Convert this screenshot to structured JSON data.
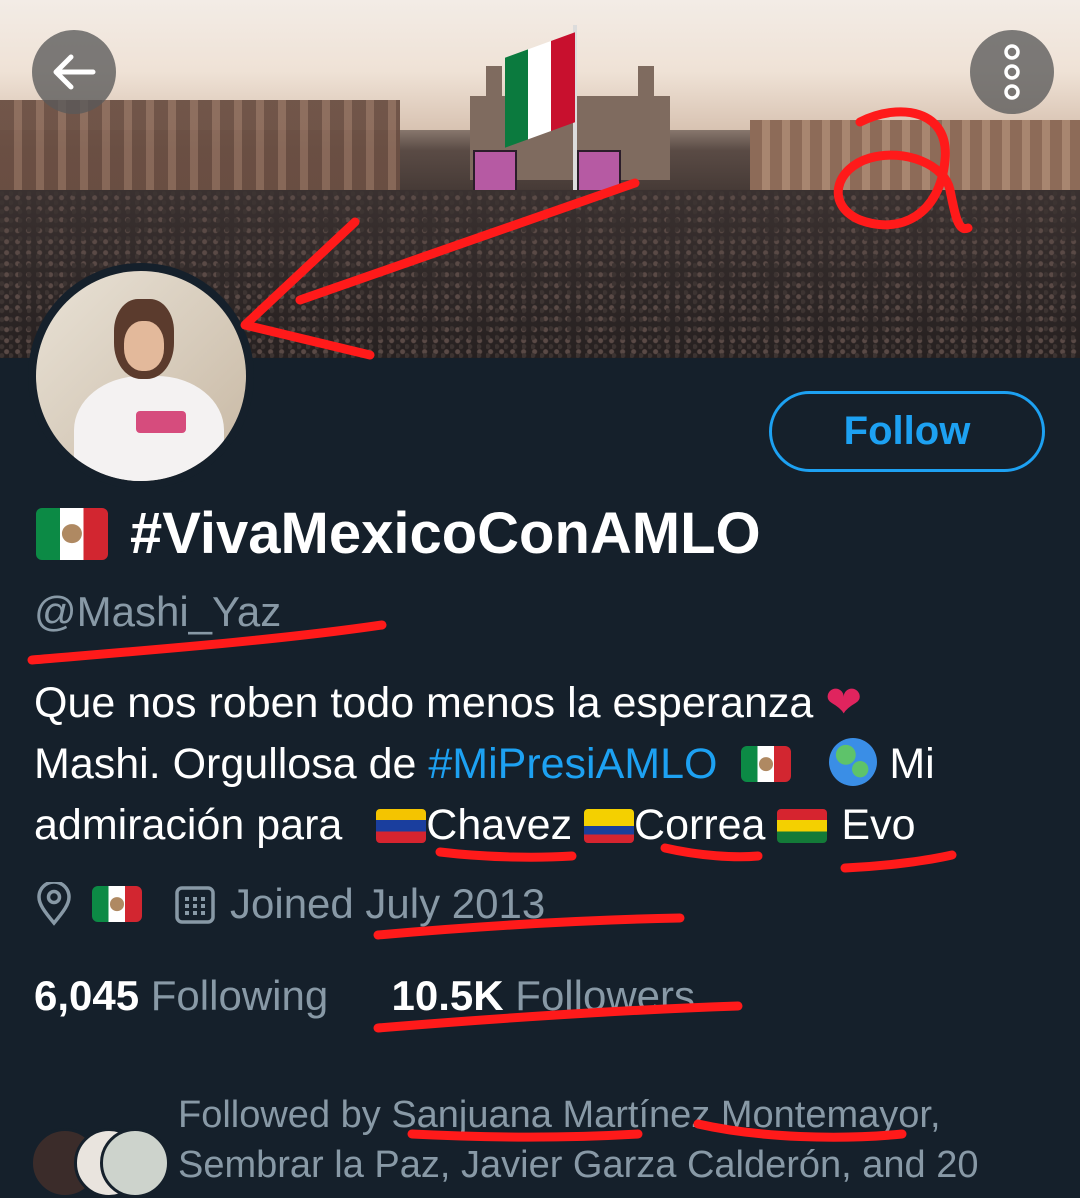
{
  "header": {
    "back_icon": "arrow-left-icon",
    "more_icon": "more-vertical-icon"
  },
  "profile": {
    "display_name": "#VivaMexicoConAMLO",
    "handle": "@Mashi_Yaz",
    "follow_label": "Follow",
    "bio_line1": "Que nos roben todo menos la esperanza",
    "bio_line2_prefix": "Mashi. Orgullosa de",
    "bio_hashtag": "#MiPresiAMLO",
    "bio_line2_suffix": "Mi",
    "bio_line3_prefix": "admiración para",
    "bio_name_1": "Chavez",
    "bio_name_2": "Correa",
    "bio_name_3": "Evo",
    "joined_label": "Joined July 2013",
    "following_count": "6,045",
    "following_label": "Following",
    "followers_count": "10.5K",
    "followers_label": "Followers",
    "followed_by": "Followed by Sanjuana Martínez Montemayor, Sembrar la Paz, Javier Garza Calderón, and 20"
  },
  "annotation_mark": "a",
  "colors": {
    "background": "#15202b",
    "accent": "#1da1f2",
    "muted": "#8899a6",
    "annotation": "#ff1a1a"
  }
}
